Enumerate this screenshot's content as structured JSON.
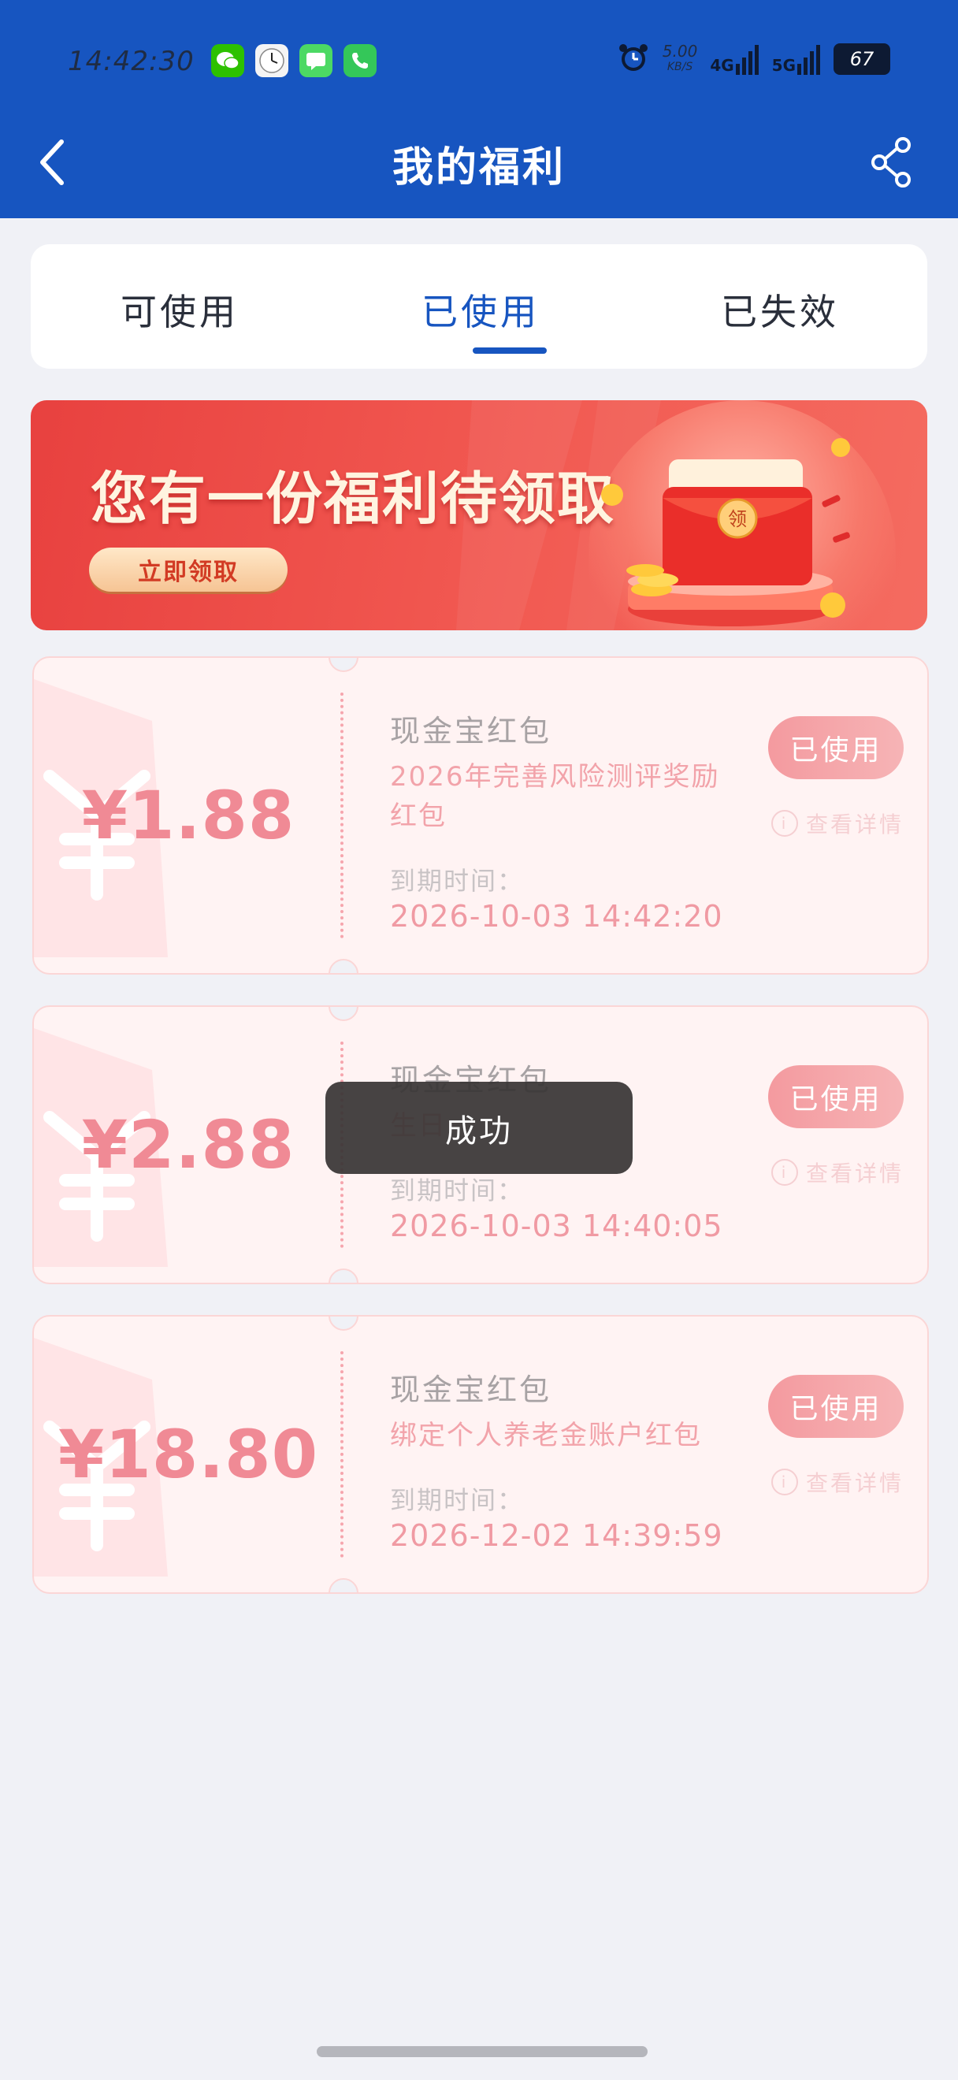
{
  "status_bar": {
    "time": "14:42:30",
    "net_speed_value": "5.00",
    "net_speed_unit": "KB/S",
    "signal_1": "4G",
    "signal_2": "5G",
    "battery": "67"
  },
  "header": {
    "title": "我的福利"
  },
  "tabs": [
    {
      "label": "可使用",
      "active": false
    },
    {
      "label": "已使用",
      "active": true
    },
    {
      "label": "已失效",
      "active": false
    }
  ],
  "banner": {
    "title": "您有一份福利待领取",
    "button": "立即领取",
    "envelope_char": "领"
  },
  "coupons": [
    {
      "amount": "¥1.88",
      "name": "现金宝红包",
      "desc": "2026年完善风险测评奖励红包",
      "expiry_label": "到期时间：",
      "expiry": "2026-10-03 14:42:20",
      "status": "已使用",
      "detail": "查看详情"
    },
    {
      "amount": "¥2.88",
      "name": "现金宝红包",
      "desc": "生日",
      "expiry_label": "到期时间：",
      "expiry": "2026-10-03 14:40:05",
      "status": "已使用",
      "detail": "查看详情"
    },
    {
      "amount": "¥18.80",
      "name": "现金宝红包",
      "desc": "绑定个人养老金账户红包",
      "expiry_label": "到期时间：",
      "expiry": "2026-12-02 14:39:59",
      "status": "已使用",
      "detail": "查看详情"
    }
  ],
  "toast": {
    "text": "成功"
  },
  "colors": {
    "primary": "#1755c0",
    "banner_red": "#e8413f",
    "coupon_pink": "#f08a95"
  }
}
